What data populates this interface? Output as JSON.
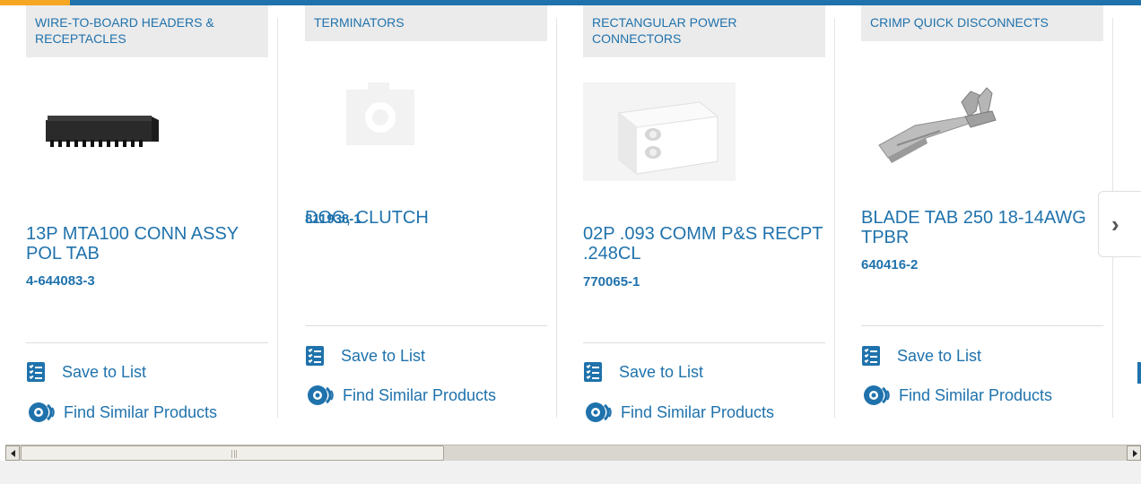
{
  "colors": {
    "brand_blue": "#1f72ac",
    "accent_orange": "#f5a623",
    "category_bg": "#ebebeb"
  },
  "actions": {
    "save_label": "Save to List",
    "similar_label": "Find Similar Products"
  },
  "cards": [
    {
      "category": "WIRE-TO-BOARD HEADERS & RECEPTACLES",
      "title": "13P MTA100 CONN ASSY POL TAB",
      "part_number": "4-644083-3",
      "image": "connector-header-black"
    },
    {
      "category": "TERMINATORS",
      "title": "DOG, CLUTCH",
      "part_number": "811938-1",
      "image": "placeholder-camera"
    },
    {
      "category": "RECTANGULAR POWER CONNECTORS",
      "title": "02P .093 COMM P&S RECPT .248CL",
      "part_number": "770065-1",
      "image": "connector-white-2pin"
    },
    {
      "category": "CRIMP QUICK DISCONNECTS",
      "title": "BLADE TAB 250 18-14AWG TPBR",
      "part_number": "640416-2",
      "image": "blade-tab-terminal"
    }
  ],
  "carousel": {
    "next_icon": "chevron-right-icon"
  }
}
